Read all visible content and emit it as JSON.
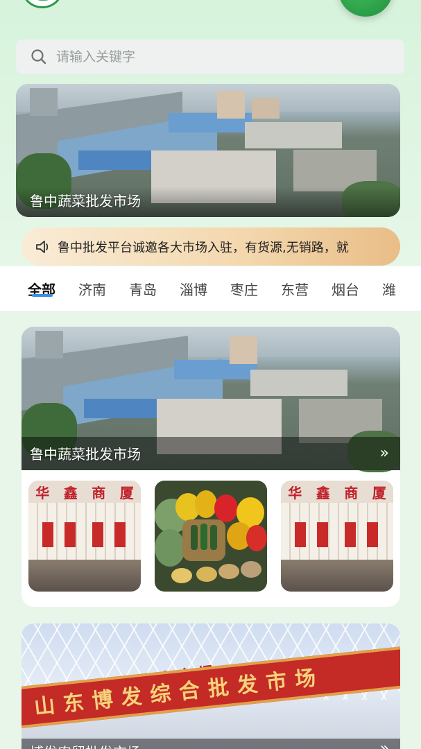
{
  "search": {
    "placeholder": "请输入关键字"
  },
  "banner": {
    "caption": "鲁中蔬菜批发市场"
  },
  "notice": {
    "text": "鲁中批发平台诚邀各大市场入驻，有货源,无销路，就"
  },
  "tabs": [
    "全部",
    "济南",
    "青岛",
    "淄博",
    "枣庄",
    "东营",
    "烟台",
    "潍"
  ],
  "active_tab": "全部",
  "market_cards": [
    {
      "title": "鲁中蔬菜批发市场",
      "thumbnails": [
        {
          "image": "storefront",
          "sign": [
            "华",
            "鑫",
            "商",
            "厦"
          ]
        },
        {
          "image": "vegetables"
        },
        {
          "image": "storefront",
          "sign": [
            "华",
            "鑫",
            "商",
            "厦"
          ]
        }
      ]
    },
    {
      "gate_top": "博农市场",
      "gate_sign": "山东博发综合批发市场",
      "title": "博发农贸批发市场"
    }
  ],
  "icons": {
    "search": "search-icon",
    "notice": "speaker-icon",
    "more": "double-chevron-right-icon"
  },
  "colors": {
    "accent_green": "#2a9a4a",
    "tab_underline": "#3a8fe0",
    "notice_gradient_start": "#f9ecd6",
    "notice_gradient_end": "#e9bd86"
  }
}
